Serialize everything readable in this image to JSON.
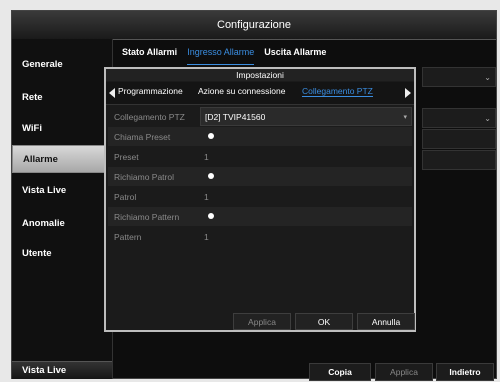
{
  "window": {
    "title": "Configurazione"
  },
  "sidebar": {
    "items": [
      {
        "label": "Generale",
        "active": false
      },
      {
        "label": "Rete",
        "active": false
      },
      {
        "label": "WiFi",
        "active": false
      },
      {
        "label": "Allarme",
        "active": true
      },
      {
        "label": "Vista Live",
        "active": false
      },
      {
        "label": "Anomalie",
        "active": false
      },
      {
        "label": "Utente",
        "active": false
      }
    ],
    "bottom_label": "Vista Live"
  },
  "tabs": [
    "Stato Allarmi",
    "Ingresso Allarme",
    "Uscita Allarme"
  ],
  "active_tab": "Ingresso Allarme",
  "footer_buttons": {
    "copy": "Copia",
    "apply": "Applica",
    "back": "Indietro"
  },
  "dialog": {
    "title": "Impostazioni",
    "tabs": [
      "Programmazione",
      "Azione su connessione",
      "Collegamento PTZ"
    ],
    "active_tab": "Collegamento PTZ",
    "params": {
      "ptz_link_label": "Collegamento PTZ",
      "ptz_link_value": "[D2] TVIP41560",
      "call_preset_label": "Chiama Preset",
      "call_preset_checked": true,
      "preset_label": "Preset",
      "preset_value": "1",
      "call_patrol_label": "Richiamo Patrol",
      "call_patrol_checked": true,
      "patrol_label": "Patrol",
      "patrol_value": "1",
      "call_pattern_label": "Richiamo Pattern",
      "call_pattern_checked": true,
      "pattern_label": "Pattern",
      "pattern_value": "1"
    },
    "buttons": {
      "apply": "Applica",
      "ok": "OK",
      "cancel": "Annulla"
    }
  },
  "colors": {
    "accent": "#3a8de0",
    "background": "#0d0d0d",
    "selected_sidebar": "#c8c8c8"
  }
}
